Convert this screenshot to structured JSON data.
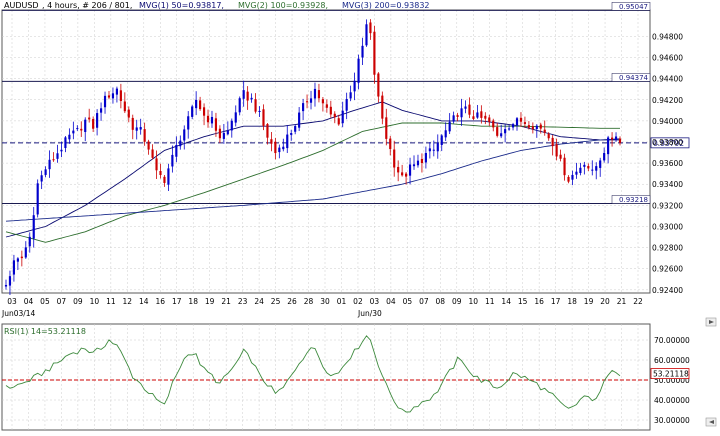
{
  "header": {
    "symbol": "AUDUSD",
    "timeframe": ", 4 hours, # 206 / 801,",
    "mvg1": "MVG(1) 50=0.93817,",
    "mvg2": "MVG(2) 100=0.93928,",
    "mvg3": "MVG(3) 200=0.93832"
  },
  "colors": {
    "bull": "#0000cc",
    "bear": "#cc0000",
    "ma50": "#0a0a70",
    "ma100": "#2e6e2e",
    "ma200": "#1a2a8a",
    "rsi": "#3d8a3d",
    "price_marker": "#1a1a80",
    "rsi_marker": "#cc0000",
    "grid": "#cccccc"
  },
  "chart_data": [
    {
      "type": "candlestick",
      "title": "AUDUSD",
      "y_axis_labels": [
        "0.94800",
        "0.94600",
        "0.94400",
        "0.94200",
        "0.94000",
        "0.93800",
        "0.93600",
        "0.93400",
        "0.93200",
        "0.93000",
        "0.92800",
        "0.92600",
        "0.92400"
      ],
      "ylim": [
        0.9237,
        0.9505
      ],
      "x_tick_labels": [
        "03",
        "04",
        "05",
        "07",
        "09",
        "10",
        "11",
        "12",
        "14",
        "16",
        "17",
        "18",
        "19",
        "21",
        "23",
        "24",
        "25",
        "26",
        "28",
        "30",
        "01",
        "02",
        "03",
        "04",
        "05",
        "07",
        "08",
        "09",
        "10",
        "11",
        "14",
        "15",
        "16",
        "17",
        "18",
        "19",
        "20",
        "21",
        "22"
      ],
      "x_sub_labels": [
        "Jun03/14",
        "Jun/30"
      ],
      "levels": [
        {
          "label": "0.95047",
          "value": 0.95047
        },
        {
          "label": "0.94374",
          "value": 0.94374
        },
        {
          "label": "0.93218",
          "value": 0.93218
        }
      ],
      "current_price": {
        "label": "0.93792",
        "value": 0.93792
      },
      "series": [
        {
          "name": "Price",
          "waypoints": [
            [
              0,
              0.9245
            ],
            [
              2,
              0.9265
            ],
            [
              4,
              0.927
            ],
            [
              6,
              0.929
            ],
            [
              8,
              0.934
            ],
            [
              10,
              0.9355
            ],
            [
              12,
              0.9365
            ],
            [
              14,
              0.9375
            ],
            [
              16,
              0.9385
            ],
            [
              18,
              0.939
            ],
            [
              20,
              0.94
            ],
            [
              22,
              0.9395
            ],
            [
              24,
              0.9415
            ],
            [
              26,
              0.9425
            ],
            [
              28,
              0.943
            ],
            [
              30,
              0.941
            ],
            [
              32,
              0.9395
            ],
            [
              34,
              0.939
            ],
            [
              36,
              0.9375
            ],
            [
              38,
              0.935
            ],
            [
              40,
              0.9345
            ],
            [
              42,
              0.9365
            ],
            [
              44,
              0.9385
            ],
            [
              46,
              0.94
            ],
            [
              48,
              0.942
            ],
            [
              50,
              0.9405
            ],
            [
              52,
              0.94
            ],
            [
              54,
              0.9385
            ],
            [
              56,
              0.939
            ],
            [
              58,
              0.941
            ],
            [
              60,
              0.9425
            ],
            [
              62,
              0.942
            ],
            [
              64,
              0.9405
            ],
            [
              66,
              0.9385
            ],
            [
              68,
              0.937
            ],
            [
              70,
              0.938
            ],
            [
              72,
              0.939
            ],
            [
              74,
              0.9405
            ],
            [
              76,
              0.942
            ],
            [
              78,
              0.943
            ],
            [
              80,
              0.9415
            ],
            [
              82,
              0.9405
            ],
            [
              84,
              0.94
            ],
            [
              86,
              0.942
            ],
            [
              88,
              0.944
            ],
            [
              90,
              0.947
            ],
            [
              91,
              0.949
            ],
            [
              92,
              0.948
            ],
            [
              93,
              0.9445
            ],
            [
              94,
              0.942
            ],
            [
              96,
              0.9385
            ],
            [
              98,
              0.936
            ],
            [
              100,
              0.9345
            ],
            [
              102,
              0.9355
            ],
            [
              104,
              0.936
            ],
            [
              106,
              0.9368
            ],
            [
              108,
              0.9372
            ],
            [
              110,
              0.9385
            ],
            [
              112,
              0.9395
            ],
            [
              114,
              0.9408
            ],
            [
              116,
              0.941
            ],
            [
              118,
              0.9405
            ],
            [
              120,
              0.9402
            ],
            [
              122,
              0.9398
            ],
            [
              124,
              0.9385
            ],
            [
              126,
              0.9395
            ],
            [
              128,
              0.9398
            ],
            [
              130,
              0.94
            ],
            [
              132,
              0.9398
            ],
            [
              134,
              0.9395
            ],
            [
              136,
              0.939
            ],
            [
              138,
              0.938
            ],
            [
              140,
              0.936
            ],
            [
              142,
              0.9345
            ],
            [
              144,
              0.9352
            ],
            [
              146,
              0.9362
            ],
            [
              148,
              0.935
            ],
            [
              150,
              0.9365
            ],
            [
              152,
              0.938
            ],
            [
              154,
              0.9388
            ],
            [
              155,
              0.9379
            ]
          ]
        },
        {
          "name": "MVG(1) 50",
          "waypoints": [
            [
              0,
              0.929
            ],
            [
              10,
              0.93
            ],
            [
              20,
              0.932
            ],
            [
              30,
              0.9345
            ],
            [
              40,
              0.9372
            ],
            [
              50,
              0.9385
            ],
            [
              60,
              0.9395
            ],
            [
              70,
              0.9395
            ],
            [
              80,
              0.94
            ],
            [
              88,
              0.941
            ],
            [
              95,
              0.9418
            ],
            [
              100,
              0.941
            ],
            [
              110,
              0.94
            ],
            [
              120,
              0.94
            ],
            [
              130,
              0.9395
            ],
            [
              140,
              0.9385
            ],
            [
              150,
              0.9382
            ],
            [
              155,
              0.9382
            ]
          ]
        },
        {
          "name": "MVG(2) 100",
          "waypoints": [
            [
              0,
              0.9295
            ],
            [
              10,
              0.9285
            ],
            [
              20,
              0.9295
            ],
            [
              30,
              0.931
            ],
            [
              40,
              0.932
            ],
            [
              50,
              0.9332
            ],
            [
              60,
              0.9345
            ],
            [
              70,
              0.9358
            ],
            [
              80,
              0.9372
            ],
            [
              90,
              0.939
            ],
            [
              100,
              0.9398
            ],
            [
              110,
              0.9398
            ],
            [
              120,
              0.9395
            ],
            [
              130,
              0.9395
            ],
            [
              140,
              0.9394
            ],
            [
              150,
              0.9393
            ],
            [
              155,
              0.9393
            ]
          ]
        },
        {
          "name": "MVG(3) 200",
          "waypoints": [
            [
              0,
              0.9305
            ],
            [
              20,
              0.931
            ],
            [
              40,
              0.9315
            ],
            [
              60,
              0.932
            ],
            [
              80,
              0.9326
            ],
            [
              100,
              0.934
            ],
            [
              110,
              0.935
            ],
            [
              120,
              0.9362
            ],
            [
              130,
              0.9372
            ],
            [
              140,
              0.9378
            ],
            [
              150,
              0.9382
            ],
            [
              155,
              0.9383
            ]
          ]
        }
      ]
    },
    {
      "type": "line",
      "title": "RSI",
      "label": "RSI(1) 14=53.21118",
      "y_axis_labels": [
        "70.00000",
        "60.00000",
        "50.00000",
        "40.00000",
        "30.00000"
      ],
      "ylim": [
        25,
        78
      ],
      "level": 50,
      "current": {
        "label": "53.21118",
        "value": 53.21118
      },
      "series": [
        {
          "name": "RSI(1) 14",
          "waypoints": [
            [
              0,
              46
            ],
            [
              4,
              48
            ],
            [
              8,
              52
            ],
            [
              12,
              57
            ],
            [
              16,
              63
            ],
            [
              20,
              66
            ],
            [
              22,
              63
            ],
            [
              24,
              66
            ],
            [
              26,
              70
            ],
            [
              28,
              67
            ],
            [
              30,
              60
            ],
            [
              32,
              52
            ],
            [
              34,
              48
            ],
            [
              36,
              44
            ],
            [
              38,
              40
            ],
            [
              40,
              37
            ],
            [
              42,
              48
            ],
            [
              44,
              57
            ],
            [
              46,
              64
            ],
            [
              48,
              62
            ],
            [
              50,
              55
            ],
            [
              52,
              52
            ],
            [
              54,
              48
            ],
            [
              56,
              53
            ],
            [
              58,
              58
            ],
            [
              60,
              64
            ],
            [
              62,
              60
            ],
            [
              64,
              52
            ],
            [
              66,
              48
            ],
            [
              68,
              43
            ],
            [
              70,
              46
            ],
            [
              72,
              52
            ],
            [
              74,
              59
            ],
            [
              76,
              64
            ],
            [
              78,
              66
            ],
            [
              80,
              58
            ],
            [
              82,
              52
            ],
            [
              84,
              54
            ],
            [
              86,
              60
            ],
            [
              88,
              64
            ],
            [
              90,
              70
            ],
            [
              91,
              72
            ],
            [
              92,
              70
            ],
            [
              93,
              64
            ],
            [
              94,
              58
            ],
            [
              96,
              47
            ],
            [
              98,
              40
            ],
            [
              100,
              34
            ],
            [
              102,
              35
            ],
            [
              104,
              38
            ],
            [
              106,
              40
            ],
            [
              108,
              42
            ],
            [
              110,
              48
            ],
            [
              112,
              54
            ],
            [
              114,
              60
            ],
            [
              116,
              58
            ],
            [
              118,
              52
            ],
            [
              120,
              50
            ],
            [
              122,
              48
            ],
            [
              124,
              46
            ],
            [
              126,
              49
            ],
            [
              128,
              53
            ],
            [
              130,
              52
            ],
            [
              132,
              50
            ],
            [
              134,
              48
            ],
            [
              136,
              45
            ],
            [
              138,
              42
            ],
            [
              140,
              38
            ],
            [
              142,
              35
            ],
            [
              144,
              38
            ],
            [
              146,
              42
            ],
            [
              148,
              39
            ],
            [
              150,
              45
            ],
            [
              152,
              52
            ],
            [
              154,
              55
            ],
            [
              155,
              53.2
            ]
          ]
        }
      ]
    }
  ]
}
